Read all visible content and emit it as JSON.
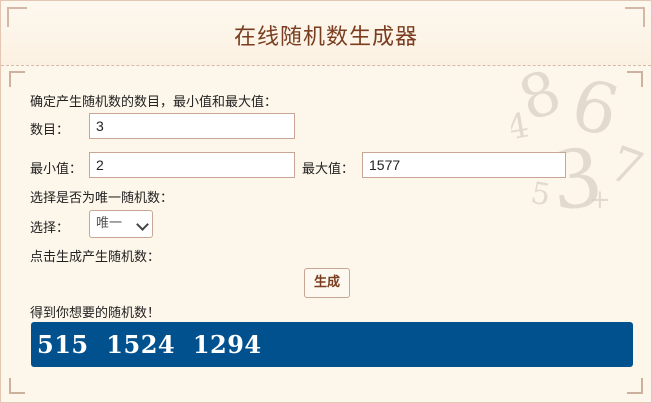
{
  "page": {
    "title": "在线随机数生成器"
  },
  "form": {
    "intro": "确定产生随机数的数目，最小值和最大值：",
    "count_label": "数目：",
    "count_value": "3",
    "min_label": "最小值：",
    "min_value": "2",
    "max_label": "最大值：",
    "max_value": "1577",
    "unique_intro": "选择是否为唯一随机数：",
    "select_label": "选择：",
    "select_value": "唯一",
    "generate_intro": "点击生成产生随机数：",
    "generate_label": "生成",
    "result_intro": "得到你想要的随机数！"
  },
  "result": {
    "numbers": "515  1524  1294"
  },
  "colors": {
    "accent": "#7a3d1f",
    "result_bg": "#02518f",
    "border": "#c9a593",
    "page_bg": "#fdf6ea"
  }
}
